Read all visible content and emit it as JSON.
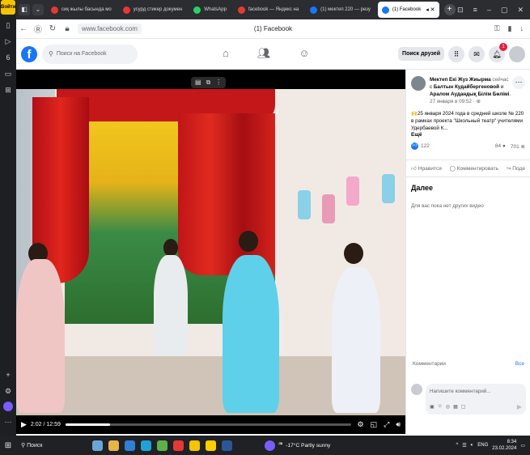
{
  "browser": {
    "rail_logo": "Войти",
    "tabs": [
      {
        "label": "сиқ жылы басында мо",
        "color": "#e53935",
        "active": false
      },
      {
        "label": "усурд стикер докумен",
        "color": "#e53935",
        "active": false
      },
      {
        "label": "WhatsApp",
        "color": "#25d366",
        "active": false
      },
      {
        "label": "facebook — Яндекс на",
        "color": "#e53935",
        "active": false
      },
      {
        "label": "(1) мектеп 220 — резу",
        "color": "#1877f2",
        "active": false
      },
      {
        "label": "(1) Facebook",
        "color": "#1877f2",
        "active": true
      }
    ],
    "url": "www.facebook.com",
    "page_title": "(1) Facebook"
  },
  "facebook": {
    "search_placeholder": "Поиск на Facebook",
    "find_friends": "Поиск друзей",
    "notif_count": "1"
  },
  "video": {
    "time": "2:02 / 12:59",
    "progress": 0.157
  },
  "post": {
    "author": "Мектеп Екі Жуз Жиырма",
    "with_text": "сейчас",
    "with_prefix": "с",
    "tag1": "Балтын Кудайбергеновой",
    "and": "и",
    "tag2": "Аралом Аудандық Білім Бөлімі",
    "date": "27 января в 09:52 · ",
    "text": "🙌25 января 2024 года в средней школе № 220 в рамках проекта \"Школьный театр\" учителями Удербаевой К...",
    "more": "Ещё",
    "likes": "122",
    "comments_count": "84",
    "shares_count": "701",
    "like_btn": "Нравится",
    "comment_btn": "Комментировать",
    "share_btn": "Поде"
  },
  "next": {
    "title": "Далее",
    "empty": "Для вас пока нет других видео"
  },
  "comments": {
    "label": "Комментарии",
    "all": "Все",
    "placeholder": "Напишите комментарий..."
  },
  "taskbar": {
    "search": "Поиск",
    "weather": "-17°C  Partly sunny",
    "lang": "ENG",
    "time": "8:34",
    "date": "23.02.2024"
  }
}
